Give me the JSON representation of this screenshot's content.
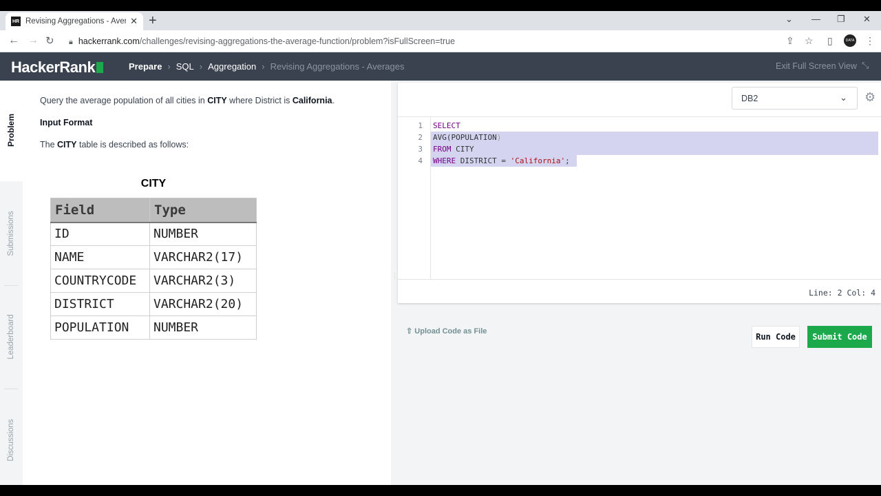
{
  "browser": {
    "tab_title": "Revising Aggregations - Average",
    "favicon_text": "HR",
    "new_tab": "+",
    "close_tab": "✕",
    "url_host": "hackerrank.com",
    "url_path": "/challenges/revising-aggregations-the-average-function/problem?isFullScreen=true",
    "avatar_text": "DATA"
  },
  "header": {
    "logo": "HackerRank",
    "breadcrumb": [
      "Prepare",
      "SQL",
      "Aggregation",
      "Revising Aggregations - Averages"
    ],
    "exit_fullscreen": "Exit Full Screen View"
  },
  "side_tabs": [
    "Problem",
    "Submissions",
    "Leaderboard",
    "Discussions"
  ],
  "problem": {
    "statement": {
      "prefix": "Query the average population of all cities in ",
      "table": "CITY",
      "middle": " where District is ",
      "district": "California",
      "suffix": "."
    },
    "input_format_title": "Input Format",
    "description": {
      "prefix": "The ",
      "table": "CITY",
      "suffix": " table is described as follows:"
    },
    "table_caption": "CITY",
    "table_headers": [
      "Field",
      "Type"
    ],
    "table_rows": [
      [
        "ID",
        "NUMBER"
      ],
      [
        "NAME",
        "VARCHAR2(17)"
      ],
      [
        "COUNTRYCODE",
        "VARCHAR2(3)"
      ],
      [
        "DISTRICT",
        "VARCHAR2(20)"
      ],
      [
        "POPULATION",
        "NUMBER"
      ]
    ]
  },
  "editor": {
    "language": "DB2",
    "line_numbers": [
      "1",
      "2",
      "3",
      "4"
    ],
    "lines": {
      "l1_kw": "SELECT",
      "l2_fn": "AVG",
      "l2_open": "(",
      "l2_arg": "POPULATION",
      "l2_close": ")",
      "l3_kw": "FROM",
      "l3_rest": " CITY",
      "l4_kw": "WHERE",
      "l4_mid": " DISTRICT = ",
      "l4_str": "'California'",
      "l4_end": ";"
    },
    "status": "Line: 2 Col: 4"
  },
  "actions": {
    "upload": "Upload Code as File",
    "run": "Run Code",
    "submit": "Submit Code"
  },
  "colors": {
    "brand_green": "#1ba94c",
    "header_bg": "#39424e",
    "selection": "#d4d4f0"
  }
}
